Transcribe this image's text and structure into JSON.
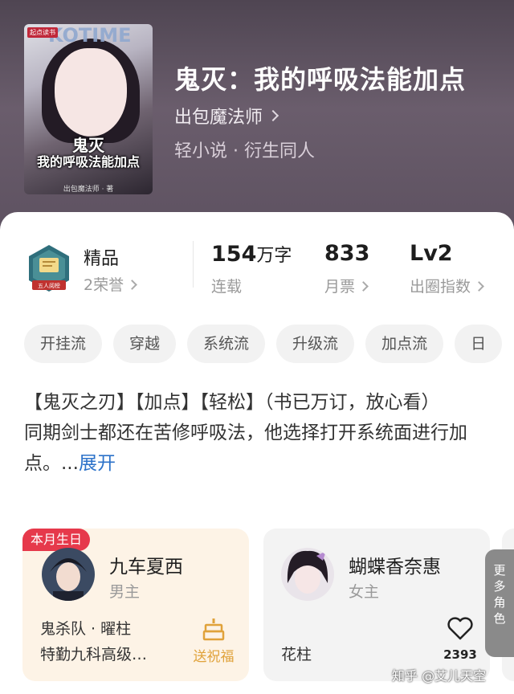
{
  "book": {
    "cover": {
      "badge": "起点读书",
      "magazine": "KOTIME",
      "title_line1": "鬼灭",
      "title_line2": "我的呼吸法能加点",
      "author": "出包魔法师 · 著"
    },
    "title": "鬼灭：我的呼吸法能加点",
    "author": "出包魔法师",
    "genre": "轻小说 · 衍生同人"
  },
  "stats": {
    "honor": {
      "badge_text": "五人阅榜",
      "label": "精品",
      "sub": "2荣誉"
    },
    "words": {
      "value": "154",
      "unit": "万字",
      "sub": "连载"
    },
    "votes": {
      "value": "833",
      "sub": "月票"
    },
    "level": {
      "value": "Lv2",
      "sub": "出圈指数"
    }
  },
  "tags": [
    "开挂流",
    "穿越",
    "系统流",
    "升级流",
    "加点流",
    "日"
  ],
  "description": {
    "text": "【鬼灭之刃】【加点】【轻松】（书已万订，放心看）\n同期剑士都还在苦修呼吸法，他选择打开系统面进行加点。...",
    "more_label": "展开"
  },
  "characters": [
    {
      "badge": "本月生日",
      "name": "九车夏西",
      "role": "男主",
      "info_line1": "鬼杀队 · 曜柱",
      "info_line2": "特勤九科高级…",
      "action_label": "送祝福",
      "action_icon": "cake-icon"
    },
    {
      "name": "蝴蝶香奈惠",
      "role": "女主",
      "info_line1": "花柱",
      "like_count": "2393",
      "action_icon": "heart-icon"
    }
  ],
  "more_roles": [
    "更",
    "多",
    "角",
    "色"
  ],
  "watermark": "知乎 @艾儿天空",
  "colors": {
    "accent_blue": "#2c72c9",
    "birthday_red": "#e6394b",
    "gift_gold": "#e0a23a"
  }
}
